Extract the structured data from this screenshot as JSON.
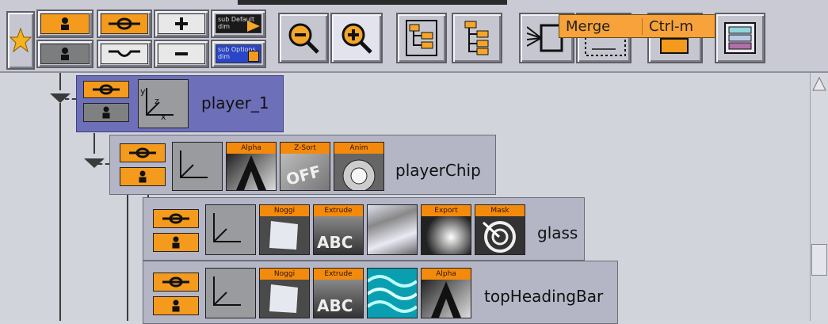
{
  "tooltip": {
    "label": "Merge",
    "shortcut": "Ctrl-m"
  },
  "toolbar": {
    "icons": [
      "star-icon",
      "container-visible-icon",
      "container-hidden-icon",
      "key-on-icon",
      "key-off-icon",
      "plus-icon",
      "minus-icon",
      "sub-default-icon",
      "sub-options-icon",
      "zoom-out-icon",
      "zoom-in-icon",
      "tree-expand-icon",
      "tree-collapse-icon",
      "merge-icon",
      "split-icon",
      "group-icon",
      "layers-icon"
    ],
    "sub_default_label": "sub Default dim",
    "sub_options_label": "sub Options dim"
  },
  "tree": {
    "nodes": [
      {
        "label": "player_1",
        "selected": true,
        "plugins": []
      },
      {
        "label": "playerChip",
        "selected": false,
        "plugins": [
          "Alpha",
          "Z-Sort",
          "Anim"
        ]
      },
      {
        "label": "glass",
        "selected": false,
        "plugins": [
          "Noggi",
          "Extrude",
          "",
          "Export",
          "Mask"
        ]
      },
      {
        "label": "topHeadingBar",
        "selected": false,
        "plugins": [
          "Noggi",
          "Extrude",
          "",
          "Alpha"
        ]
      }
    ],
    "axis_labels": {
      "y": "y",
      "z": "z",
      "x": "x"
    }
  },
  "colors": {
    "accent": "#f49a1c",
    "selected": "#6d6fb8",
    "node": "#b4b6c6"
  }
}
